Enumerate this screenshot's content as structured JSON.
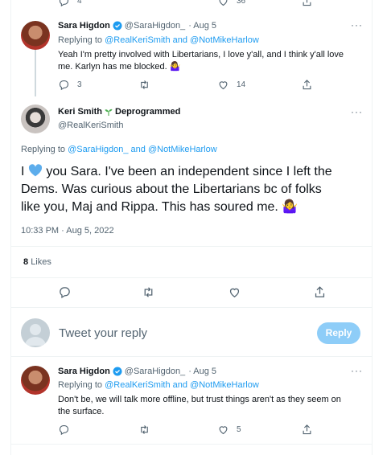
{
  "top_actions": {
    "reply_count": "4",
    "like_count": "36"
  },
  "reply1": {
    "name": "Sara Higdon",
    "handle": "@SaraHigdon_",
    "date": "· Aug 5",
    "replying_prefix": "Replying to",
    "replying_users": "@RealKeriSmith and @NotMikeHarlow",
    "text_line1": "Yeah I'm pretty involved with Libertarians, I love y'all, and I think y'all love",
    "text_line2": "me. Karlyn has me blocked. 🤷‍♀️",
    "reply_count": "3",
    "like_count": "14"
  },
  "main": {
    "name": "Keri Smith",
    "name_suffix": "Deprogrammed",
    "handle": "@RealKeriSmith",
    "replying_prefix": "Replying to",
    "replying_users": "@SaraHigdon_ and @NotMikeHarlow",
    "text_line1_a": "I",
    "text_line1_b": "you Sara. I've been an independent since I left the",
    "text_line2": "Dems. Was curious about the Libertarians bc of folks",
    "text_line3": "like you, Maj and Rippa. This has soured me. 🤷‍♀️",
    "timestamp": "10:33 PM · Aug 5, 2022",
    "likes_count": "8",
    "likes_label": "Likes"
  },
  "compose": {
    "placeholder": "Tweet your reply",
    "button": "Reply"
  },
  "reply2": {
    "name": "Sara Higdon",
    "handle": "@SaraHigdon_",
    "date": "· Aug 5",
    "replying_prefix": "Replying to",
    "replying_users": "@RealKeriSmith and @NotMikeHarlow",
    "text_line1": "Don't be, we will talk more offline, but trust things aren't as they seem on",
    "text_line2": "the surface.",
    "like_count": "5"
  },
  "colors": {
    "accent": "#1d9bf0",
    "text": "#0f1419",
    "muted": "#536471",
    "reply_button_disabled": "#8ecdf8"
  },
  "icons": [
    "reply-icon",
    "retweet-icon",
    "like-icon",
    "share-icon",
    "more-icon",
    "verified-badge-icon",
    "seedling-emoji",
    "blue-heart-emoji"
  ]
}
